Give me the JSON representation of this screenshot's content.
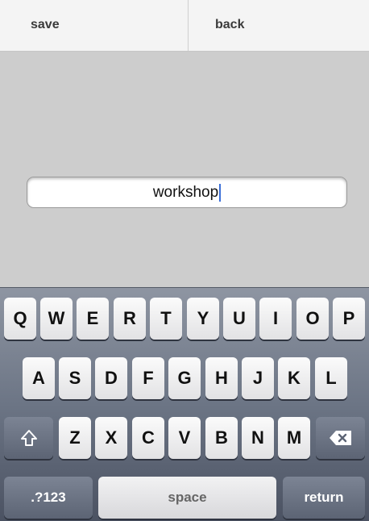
{
  "topbar": {
    "save_label": "save",
    "back_label": "back"
  },
  "field": {
    "value": "workshop"
  },
  "keyboard": {
    "row1": [
      "Q",
      "W",
      "E",
      "R",
      "T",
      "Y",
      "U",
      "I",
      "O",
      "P"
    ],
    "row2": [
      "A",
      "S",
      "D",
      "F",
      "G",
      "H",
      "J",
      "K",
      "L"
    ],
    "row3": [
      "Z",
      "X",
      "C",
      "V",
      "B",
      "N",
      "M"
    ],
    "shift_icon": "shift-icon",
    "delete_icon": "backspace-icon",
    "numbers_label": ".?123",
    "space_label": "space",
    "return_label": "return"
  }
}
